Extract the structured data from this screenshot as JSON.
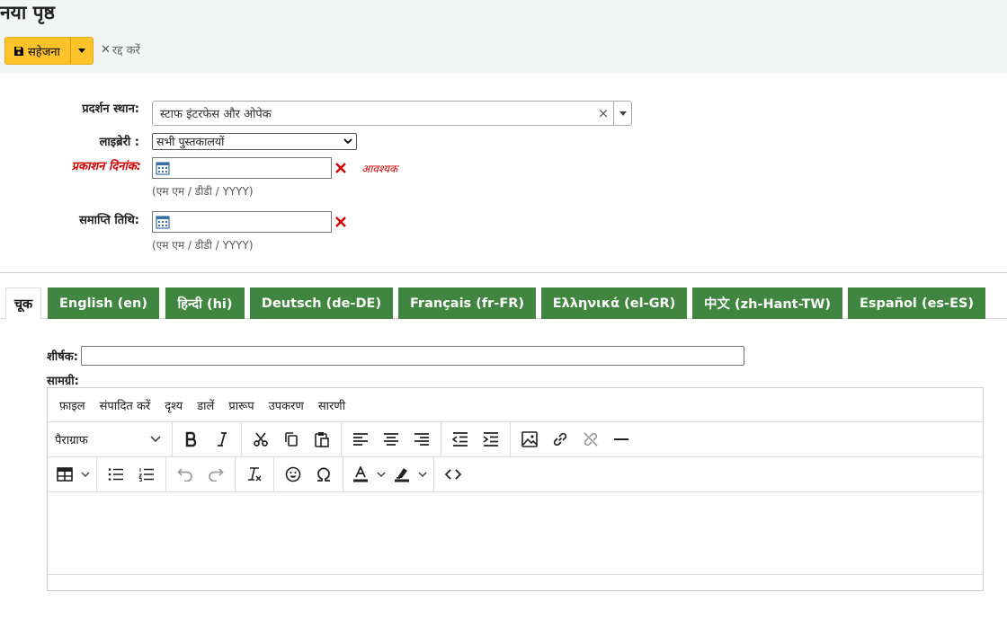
{
  "page": {
    "title": "नया पृष्ठ"
  },
  "toolbar": {
    "save_label": "सहेजना",
    "cancel_label": "रद्द करें"
  },
  "form": {
    "display_location_label": "प्रदर्शन स्थान:",
    "display_location_value": "स्टाफ इंटरफेस और ओपेक",
    "library_label": "लाइब्रेरी :",
    "library_value": "सभी पुस्तकालयों",
    "publish_date_label": "प्रकाशन दिनांक:",
    "required_note": "आवश्यक",
    "date_hint": "(एम एम / डीडी / YYYY)",
    "expiry_date_label": "समाप्ति तिथि:"
  },
  "tabs": [
    {
      "label": "चूक"
    },
    {
      "label": "English (en)"
    },
    {
      "label": "हिन्दी (hi)"
    },
    {
      "label": "Deutsch (de-DE)"
    },
    {
      "label": "Français (fr-FR)"
    },
    {
      "label": "Ελληνικά (el-GR)"
    },
    {
      "label": "中文 (zh-Hant-TW)"
    },
    {
      "label": "Español (es-ES)"
    }
  ],
  "content": {
    "title_label": "शीर्षक:",
    "body_label": "सामग्री:"
  },
  "editor": {
    "menu": [
      "फ़ाइल",
      "संपादित करें",
      "दृश्य",
      "डालें",
      "प्रारूप",
      "उपकरण",
      "सारणी"
    ],
    "block_format": "पैराग्राफ"
  },
  "colors": {
    "save_button": "#ffc32b",
    "tab_green": "#408540",
    "required_red": "#cc0000"
  }
}
